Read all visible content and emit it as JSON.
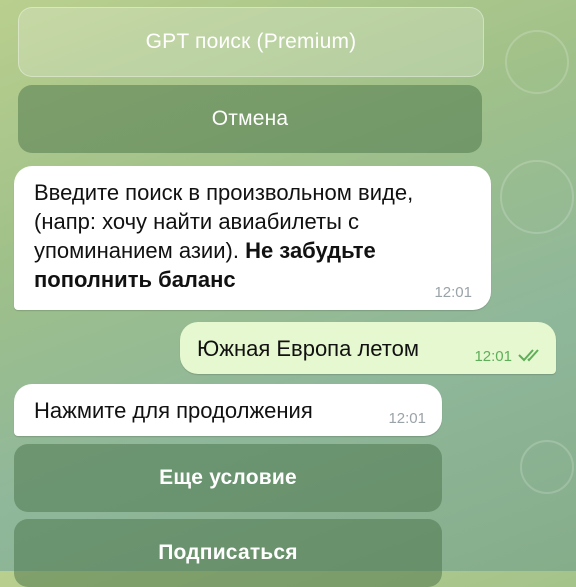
{
  "keyboard_top": {
    "gpt_search_label": "GPT поиск (Premium)",
    "cancel_label": "Отмена"
  },
  "messages": [
    {
      "direction": "incoming",
      "text_normal": "Введите поиск в произвольном виде, (напр: хочу найти авиабилеты с упоминанием азии). ",
      "text_bold": "Не забудьте пополнить баланс",
      "time": "12:01"
    },
    {
      "direction": "outgoing",
      "text": "Южная Европа летом",
      "time": "12:01",
      "status": "read-double-check"
    },
    {
      "direction": "incoming",
      "text": "Нажмите для продолжения",
      "time": "12:01"
    }
  ],
  "keyboard_bottom": {
    "more_condition_label": "Еще условие",
    "subscribe_label": "Подписаться"
  },
  "colors": {
    "incoming_bubble": "#ffffff",
    "outgoing_bubble": "#e6f8d0",
    "check_color": "#5fae5a"
  }
}
